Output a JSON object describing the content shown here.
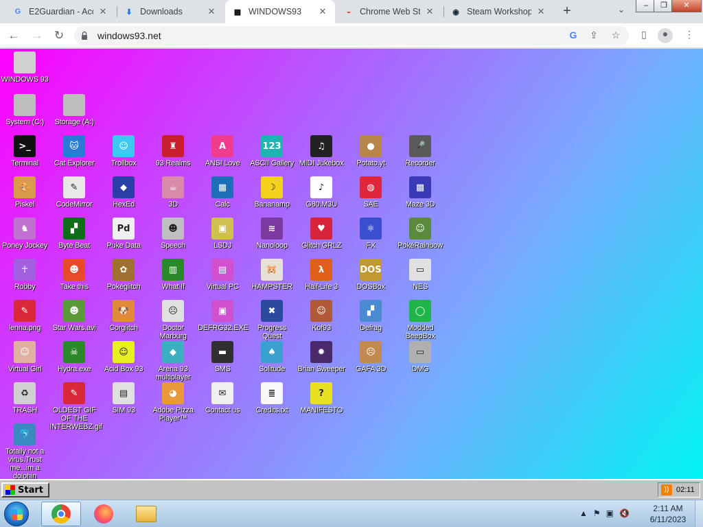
{
  "browser": {
    "tabs": [
      {
        "title": "E2Guardian - Acce",
        "favicon": "G"
      },
      {
        "title": "Downloads",
        "favicon": "download-icon"
      },
      {
        "title": "WINDOWS93",
        "favicon": "w93-icon"
      },
      {
        "title": "Chrome Web Stor",
        "favicon": "chrome-webstore-icon"
      },
      {
        "title": "Steam Workshop:",
        "favicon": "steam-icon"
      }
    ],
    "url": "windows93.net",
    "new_tab": "+"
  },
  "window_controls": {
    "minimize": "–",
    "restore": "❐",
    "close": "✕"
  },
  "desktop": {
    "top_icons": [
      {
        "label": "WINDOWS 93",
        "icon": "computer-icon",
        "color": "#d0d0d0"
      },
      {
        "label": "System (C:)",
        "icon": "drive-icon",
        "color": "#bdbdbd"
      },
      {
        "label": "Storage (A:)",
        "icon": "floppy-drive-icon",
        "color": "#bdbdbd"
      }
    ],
    "grid": [
      [
        {
          "label": "Terminal",
          "glyph": ">_",
          "color": "#111111"
        },
        {
          "label": "Cat Explorer",
          "glyph": "🐱",
          "color": "#2a7bd5"
        },
        {
          "label": "Trollbox",
          "glyph": "☺",
          "color": "#3cc8f0"
        },
        {
          "label": "93 Realms",
          "glyph": "♜",
          "color": "#c81e2d"
        },
        {
          "label": "ANSI Love",
          "glyph": "A",
          "color": "#f03c8c"
        },
        {
          "label": "ASCII Gallery",
          "glyph": "123",
          "color": "#1eb4b4"
        },
        {
          "label": "MIDI Jukebox",
          "glyph": "♫",
          "color": "#222222"
        },
        {
          "label": "Potato.yt",
          "glyph": "●",
          "color": "#b8864b"
        },
        {
          "label": "Recorder",
          "glyph": "🎤",
          "color": "#5a5a5a"
        }
      ],
      [
        {
          "label": "Piskel",
          "glyph": "🎨",
          "color": "#d99b4a"
        },
        {
          "label": "CodeMirror",
          "glyph": "✎",
          "color": "#e8e8e8"
        },
        {
          "label": "HexEd",
          "glyph": "◆",
          "color": "#2a3fa8"
        },
        {
          "label": "3D",
          "glyph": "☕",
          "color": "#d88aa8"
        },
        {
          "label": "Calc",
          "glyph": "▦",
          "color": "#1f6fb8"
        },
        {
          "label": "Bananamp",
          "glyph": "☽",
          "color": "#f2d21c"
        },
        {
          "label": "G80.M3U",
          "glyph": "♪",
          "color": "#ffffff"
        },
        {
          "label": "SAE",
          "glyph": "◍",
          "color": "#e0263c"
        },
        {
          "label": "Maze 3D",
          "glyph": "▩",
          "color": "#3a3ab8"
        }
      ],
      [
        {
          "label": "Poney Jockey",
          "glyph": "♞",
          "color": "#c070d0"
        },
        {
          "label": "Byte Beat",
          "glyph": "▞",
          "color": "#0f6e1a"
        },
        {
          "label": "Puke Data",
          "glyph": "Pd",
          "color": "#f0f0f0"
        },
        {
          "label": "Speech",
          "glyph": "☻",
          "color": "#bfbfbf"
        },
        {
          "label": "LSDJ",
          "glyph": "▣",
          "color": "#d0c050"
        },
        {
          "label": "Nanoloop",
          "glyph": "≋",
          "color": "#7a3aa0"
        },
        {
          "label": "Glitch GRLZ",
          "glyph": "♥",
          "color": "#d8243a"
        },
        {
          "label": "FX",
          "glyph": "⚛",
          "color": "#3a4fd0"
        },
        {
          "label": "PokéRainbow",
          "glyph": "☺",
          "color": "#5a8a3a"
        }
      ],
      [
        {
          "label": "Robby",
          "glyph": "☥",
          "color": "#a060e0"
        },
        {
          "label": "Take this",
          "glyph": "☻",
          "color": "#e84a2a"
        },
        {
          "label": "Pokéglitch",
          "glyph": "✿",
          "color": "#a07030"
        },
        {
          "label": "What If",
          "glyph": "▥",
          "color": "#2a8a2a"
        },
        {
          "label": "Virtual PC",
          "glyph": "▤",
          "color": "#d050d0"
        },
        {
          "label": "HAMPSTER",
          "glyph": "🐹",
          "color": "#e6e0d6"
        },
        {
          "label": "Half-Life 3",
          "glyph": "λ",
          "color": "#e0601a"
        },
        {
          "label": "DOSBox",
          "glyph": "DOS",
          "color": "#c09a30"
        },
        {
          "label": "NES",
          "glyph": "▭",
          "color": "#e0e0e0"
        }
      ],
      [
        {
          "label": "lenna.png",
          "glyph": "✎",
          "color": "#d8283a"
        },
        {
          "label": "Star Wars.avi",
          "glyph": "☻",
          "color": "#5a9a3a"
        },
        {
          "label": "Corglitch",
          "glyph": "🐶",
          "color": "#e08a3a"
        },
        {
          "label": "Doctor Marburg",
          "glyph": "☹",
          "color": "#e0e0e0"
        },
        {
          "label": "DEFRG32.EXE",
          "glyph": "▣",
          "color": "#d050d0"
        },
        {
          "label": "Progress Quest",
          "glyph": "✖",
          "color": "#2a4aa0"
        },
        {
          "label": "Kof93",
          "glyph": "☺",
          "color": "#b05a3a"
        },
        {
          "label": "Defrag",
          "glyph": "▞",
          "color": "#4a8ad0"
        },
        {
          "label": "Modded BeepBox",
          "glyph": "◯",
          "color": "#1fb54a"
        }
      ],
      [
        {
          "label": "Virtual Girl",
          "glyph": "☺",
          "color": "#e0b0a0"
        },
        {
          "label": "Hydra.exe",
          "glyph": "☠",
          "color": "#2a8a2a"
        },
        {
          "label": "Acid Box 93",
          "glyph": "☺",
          "color": "#e8f020"
        },
        {
          "label": "Arena 93 multiplayer",
          "glyph": "◆",
          "color": "#3ab0c0"
        },
        {
          "label": "SMS",
          "glyph": "▬",
          "color": "#303030"
        },
        {
          "label": "Solitude",
          "glyph": "♠",
          "color": "#3aa0d0"
        },
        {
          "label": "Brian Sweeper",
          "glyph": "✹",
          "color": "#4a2a6a"
        },
        {
          "label": "GAFA 3D",
          "glyph": "☹",
          "color": "#c08a50"
        },
        {
          "label": "DMG",
          "glyph": "▭",
          "color": "#b0b0b0"
        }
      ],
      [
        {
          "label": "TRASH",
          "glyph": "♻",
          "color": "#d0d0d0"
        },
        {
          "label": "OLDEST GIF OF THE INTERWEBZ.gif",
          "glyph": "✎",
          "color": "#d8283a"
        },
        {
          "label": "SIM 93",
          "glyph": "▤",
          "color": "#e0e0e0"
        },
        {
          "label": "Adobe Pizza Player™",
          "glyph": "◕",
          "color": "#e89a3a"
        },
        {
          "label": "Contact us",
          "glyph": "✉",
          "color": "#f0f0f0"
        },
        {
          "label": "Credits.txt",
          "glyph": "≣",
          "color": "#f8f8f8"
        },
        {
          "label": "MANIFESTO",
          "glyph": "?",
          "color": "#e8e020"
        }
      ],
      [
        {
          "label": "Totally not a virus.Trust me...im a dolphin",
          "glyph": "🐬",
          "color": "#3a8ac0"
        }
      ]
    ]
  },
  "w93_taskbar": {
    "start_label": "Start",
    "clock": "02:11",
    "rss_icon": "rss-icon"
  },
  "win7_taskbar": {
    "time": "2:11 AM",
    "date": "6/11/2023"
  }
}
